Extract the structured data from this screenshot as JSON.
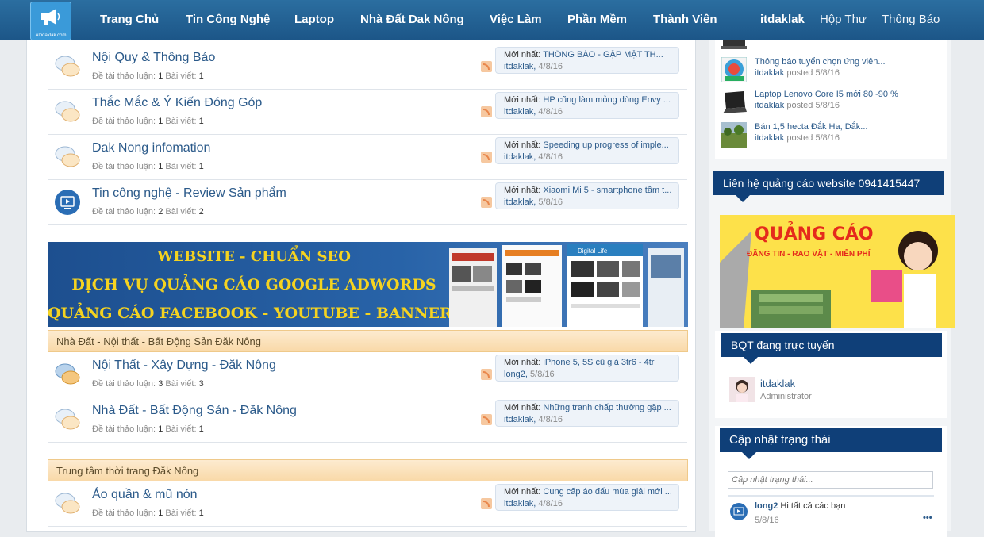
{
  "logo": {
    "text": "Alodaklak.com"
  },
  "nav": {
    "items": [
      "Trang Chủ",
      "Tin Công Nghệ",
      "Laptop",
      "Nhà Đất Dak Nông",
      "Việc Làm",
      "Phần Mềm",
      "Thành Viên"
    ],
    "user": "itdaklak",
    "inbox": "Hộp Thư",
    "alerts": "Thông Báo"
  },
  "labels": {
    "threads": "Đề tài thảo luận:",
    "posts": "Bài viết:",
    "latest": "Mới nhất:"
  },
  "forums_top": [
    {
      "title": "Nội Quy & Thông Báo",
      "threads": "1",
      "posts": "1",
      "latest_title": "THÔNG BÁO - GẶP MẶT TH...",
      "latest_user": "itdaklak",
      "latest_date": "4/8/16"
    },
    {
      "title": "Thắc Mắc & Ý Kiến Đóng Góp",
      "threads": "1",
      "posts": "1",
      "latest_title": "HP cũng làm mỏng dòng Envy ...",
      "latest_user": "itdaklak",
      "latest_date": "4/8/16"
    },
    {
      "title": "Dak Nong infomation",
      "threads": "1",
      "posts": "1",
      "latest_title": "Speeding up progress of imple...",
      "latest_user": "itdaklak",
      "latest_date": "4/8/16"
    },
    {
      "title": "Tin công nghệ - Review Sản phẩm",
      "threads": "2",
      "posts": "2",
      "latest_title": "Xiaomi Mi 5 - smartphone tầm t...",
      "latest_user": "itdaklak",
      "latest_date": "5/8/16"
    }
  ],
  "banner": {
    "line1": "WEBSITE - CHUẨN SEO",
    "line2": "DỊCH VỤ QUẢNG CÁO GOOGLE ADWORDS",
    "line3": "QUẢNG CÁO FACEBOOK - YOUTUBE - BANNER-...",
    "shot_label": "Digital Life"
  },
  "category1": {
    "title": "Nhà Đất - Nội thất - Bất Động Sản Đăk Nông",
    "forums": [
      {
        "title": "Nội Thất - Xây Dựng - Đăk Nông",
        "threads": "3",
        "posts": "3",
        "latest_title": "iPhone 5, 5S cũ giá 3tr6 - 4tr",
        "latest_user": "long2",
        "latest_date": "5/8/16"
      },
      {
        "title": "Nhà Đất - Bất Động Sản - Đăk Nông",
        "threads": "1",
        "posts": "1",
        "latest_title": "Những tranh chấp thường gặp ...",
        "latest_user": "itdaklak",
        "latest_date": "4/8/16"
      }
    ]
  },
  "category2": {
    "title": "Trung tâm thời trang Đăk Nông",
    "forums": [
      {
        "title": "Áo quần & mũ nón",
        "threads": "1",
        "posts": "1",
        "latest_title": "Cung cấp áo đấu mùa giải mới ...",
        "latest_user": "itdaklak",
        "latest_date": "4/8/16"
      }
    ]
  },
  "sidebar": {
    "recent": [
      {
        "title": "Thông báo tuyển chọn ứng viên...",
        "user": "itdaklak",
        "posted": "posted",
        "date": "5/8/16"
      },
      {
        "title": "Laptop Lenovo Core I5 mới 80 -90 %",
        "user": "itdaklak",
        "posted": "posted",
        "date": "5/8/16"
      },
      {
        "title": "Bán 1,5 hecta Đắk Ha, Dắk...",
        "user": "itdaklak",
        "posted": "posted",
        "date": "5/8/16"
      }
    ],
    "ad_header": "Liên hệ quảng cáo website 0941415447",
    "ad": {
      "title": "QUẢNG CÁO",
      "sub": "ĐĂNG TIN - RAO VẶT - MIỄN PHÍ"
    },
    "staff_header": "BQT đang trực tuyến",
    "staff": {
      "name": "itdaklak",
      "role": "Administrator"
    },
    "status_header": "Cập nhật trạng thái",
    "status_placeholder": "Cập nhật trạng thái...",
    "status_post": {
      "user": "long2",
      "text": "Hi tất cả các bạn",
      "date": "5/8/16",
      "more": "•••"
    }
  },
  "colors": {
    "nav": "#1c5688",
    "link": "#2b5a8a",
    "sidebar_header": "#0f3f78",
    "category_bar": "#f9d9a8"
  }
}
